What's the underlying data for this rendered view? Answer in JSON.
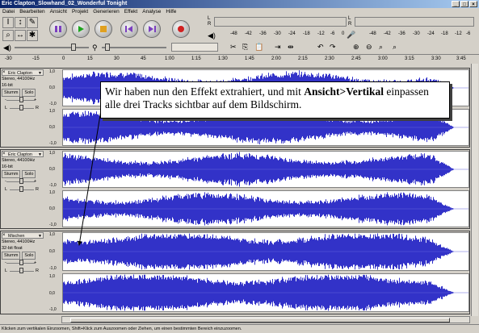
{
  "window": {
    "title": "Eric Clapton_Slowhand_02_Wonderful Tonight"
  },
  "menu": [
    "Datei",
    "Bearbeiten",
    "Ansicht",
    "Projekt",
    "Generieren",
    "Effekt",
    "Analyse",
    "Hilfe"
  ],
  "meter": {
    "channel_left": "L",
    "channel_right": "R",
    "ticks": [
      "-48",
      "-42",
      "-36",
      "-30",
      "-24",
      "-18",
      "-12",
      "-6",
      "0"
    ]
  },
  "ruler": {
    "ticks": [
      "-30",
      "-15",
      "0",
      "15",
      "30",
      "45",
      "1:00",
      "1:15",
      "1:30",
      "1:45",
      "2:00",
      "2:15",
      "2:30",
      "2:45",
      "3:00",
      "3:15",
      "3:30",
      "3:45"
    ]
  },
  "tracks": [
    {
      "name": "Eric Clapton",
      "rate": "Stereo, 44100Hz",
      "format": "16-bit",
      "mute": "Stumm",
      "solo": "Solo",
      "pan_l": "L",
      "pan_r": "R",
      "scale": [
        "1,0",
        "0,0",
        "-1,0",
        "1,0",
        "0,0",
        "-1,0"
      ],
      "color": "#3232c8"
    },
    {
      "name": "Eric Clapton",
      "rate": "Stereo, 44100Hz",
      "format": "16-bit",
      "mute": "Stumm",
      "solo": "Solo",
      "pan_l": "L",
      "pan_r": "R",
      "scale": [
        "1,0",
        "0,0",
        "-1,0",
        "1,0",
        "0,0",
        "-1,0"
      ],
      "color": "#3232c8"
    },
    {
      "name": "Mischen",
      "rate": "Stereo, 44100Hz",
      "format": "32-bit float",
      "mute": "Stumm",
      "solo": "Solo",
      "pan_l": "L",
      "pan_r": "R",
      "scale": [
        "1,0",
        "0,0",
        "-1,0",
        "1,0",
        "0,0",
        "-1,0"
      ],
      "color": "#3232c8"
    }
  ],
  "callout": {
    "part1": "Wir haben nun den Effekt extrahiert, und mit ",
    "bold": "Ansicht>Vertikal",
    "part2": " einpassen alle drei Tracks sichtbar auf dem Bildschirm."
  },
  "status": "Klicken zum vertikalen Einzoomen, Shift+Klick zum Auszoomen oder Ziehen, um einen bestimmten Bereich einzuzoomen."
}
